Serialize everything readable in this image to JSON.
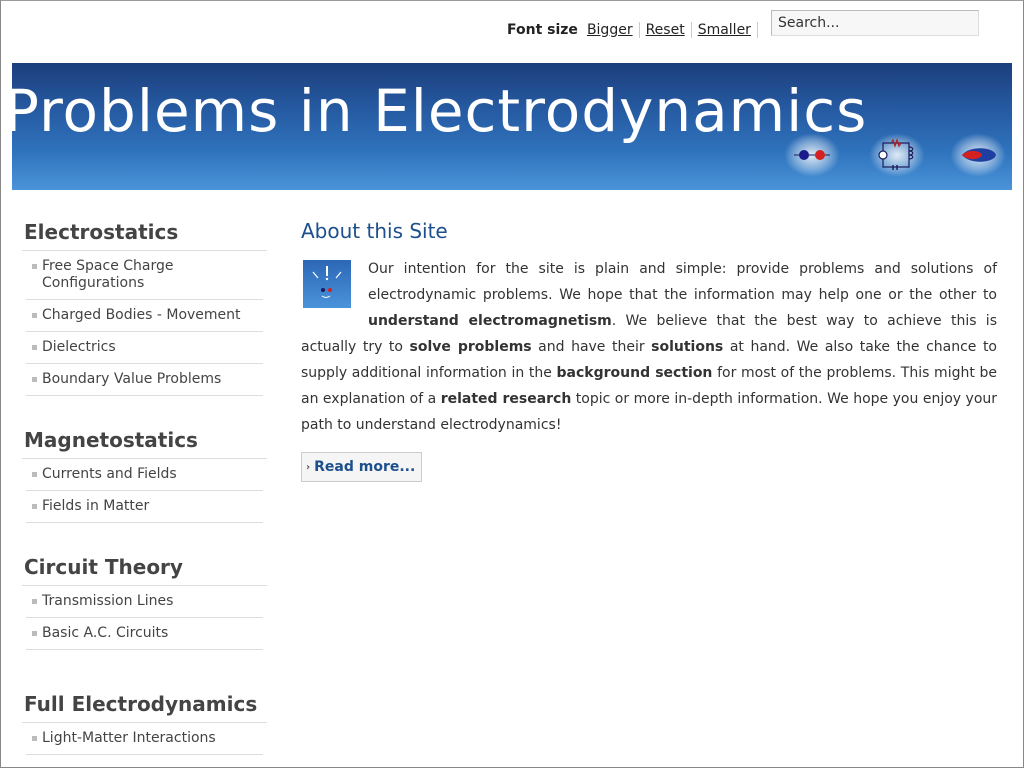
{
  "header": {
    "font_size_label": "Font size",
    "bigger": "Bigger",
    "reset": "Reset",
    "smaller": "Smaller",
    "search_value": "Search..."
  },
  "banner": {
    "title": "Problems in Electrodynamics"
  },
  "sidebar": {
    "sections": [
      {
        "heading": "Electrostatics",
        "items": [
          "Free Space Charge Configurations",
          "Charged Bodies - Movement",
          "Dielectrics",
          "Boundary Value Problems"
        ]
      },
      {
        "heading": "Magnetostatics",
        "items": [
          "Currents and Fields",
          "Fields in Matter"
        ]
      },
      {
        "heading": "Circuit Theory",
        "items": [
          "Transmission Lines",
          "Basic A.C. Circuits"
        ]
      },
      {
        "heading": "Full Electrodynamics",
        "items": [
          "Light-Matter Interactions"
        ]
      }
    ]
  },
  "main": {
    "title": "About this Site",
    "read_more": "Read more...",
    "article": {
      "t1": "Our intention for the site is plain and simple: provide problems and solutions of electrodynamic problems. We hope that the information may help one or the other to ",
      "b1": "understand electromagnetism",
      "t2": ". We believe that the best way to achieve this is actually try to ",
      "b2": "solve problems",
      "t3": " and have their ",
      "b3": "solutions",
      "t4": " at hand. We also take the chance to supply additional information in the ",
      "b4": "background section",
      "t5": " for most of the problems. This might be an explanation of a ",
      "b5": "related research",
      "t6": " topic or more in-depth information. We hope you enjoy your path to understand electrodynamics!"
    }
  },
  "colors": {
    "banner_dark": "#1c3e7c",
    "banner_light": "#4a94d9",
    "heading_blue": "#1c4f8c"
  }
}
